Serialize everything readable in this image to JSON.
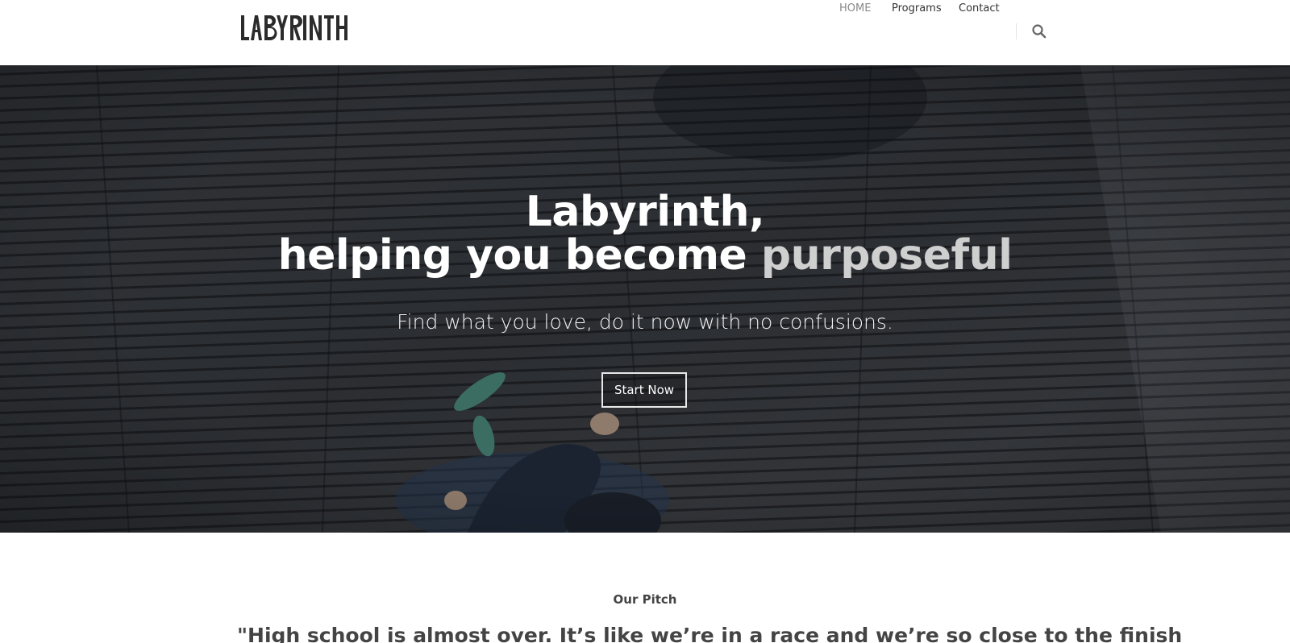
{
  "header": {
    "logo_text": "LABYRINTH",
    "nav": [
      {
        "label": "HOME",
        "active": true
      },
      {
        "label": "Programs",
        "active": false
      },
      {
        "label": "Contact",
        "active": false
      }
    ],
    "search_icon": "search-icon"
  },
  "hero": {
    "title_line1": "Labyrinth,",
    "title_line2_main": "helping you become ",
    "title_line2_accent": "purposeful",
    "subtitle": "Find what you love, do it now with no confusions.",
    "cta_label": "Start Now"
  },
  "pitch": {
    "label": "Our Pitch",
    "quote": "\"High school is almost over. It’s like we’re in a race and we’re so close to the finish"
  },
  "colors": {
    "accent_text": "#cfcfcf",
    "hero_dark": "#2e3034",
    "nav_active": "#888888"
  }
}
